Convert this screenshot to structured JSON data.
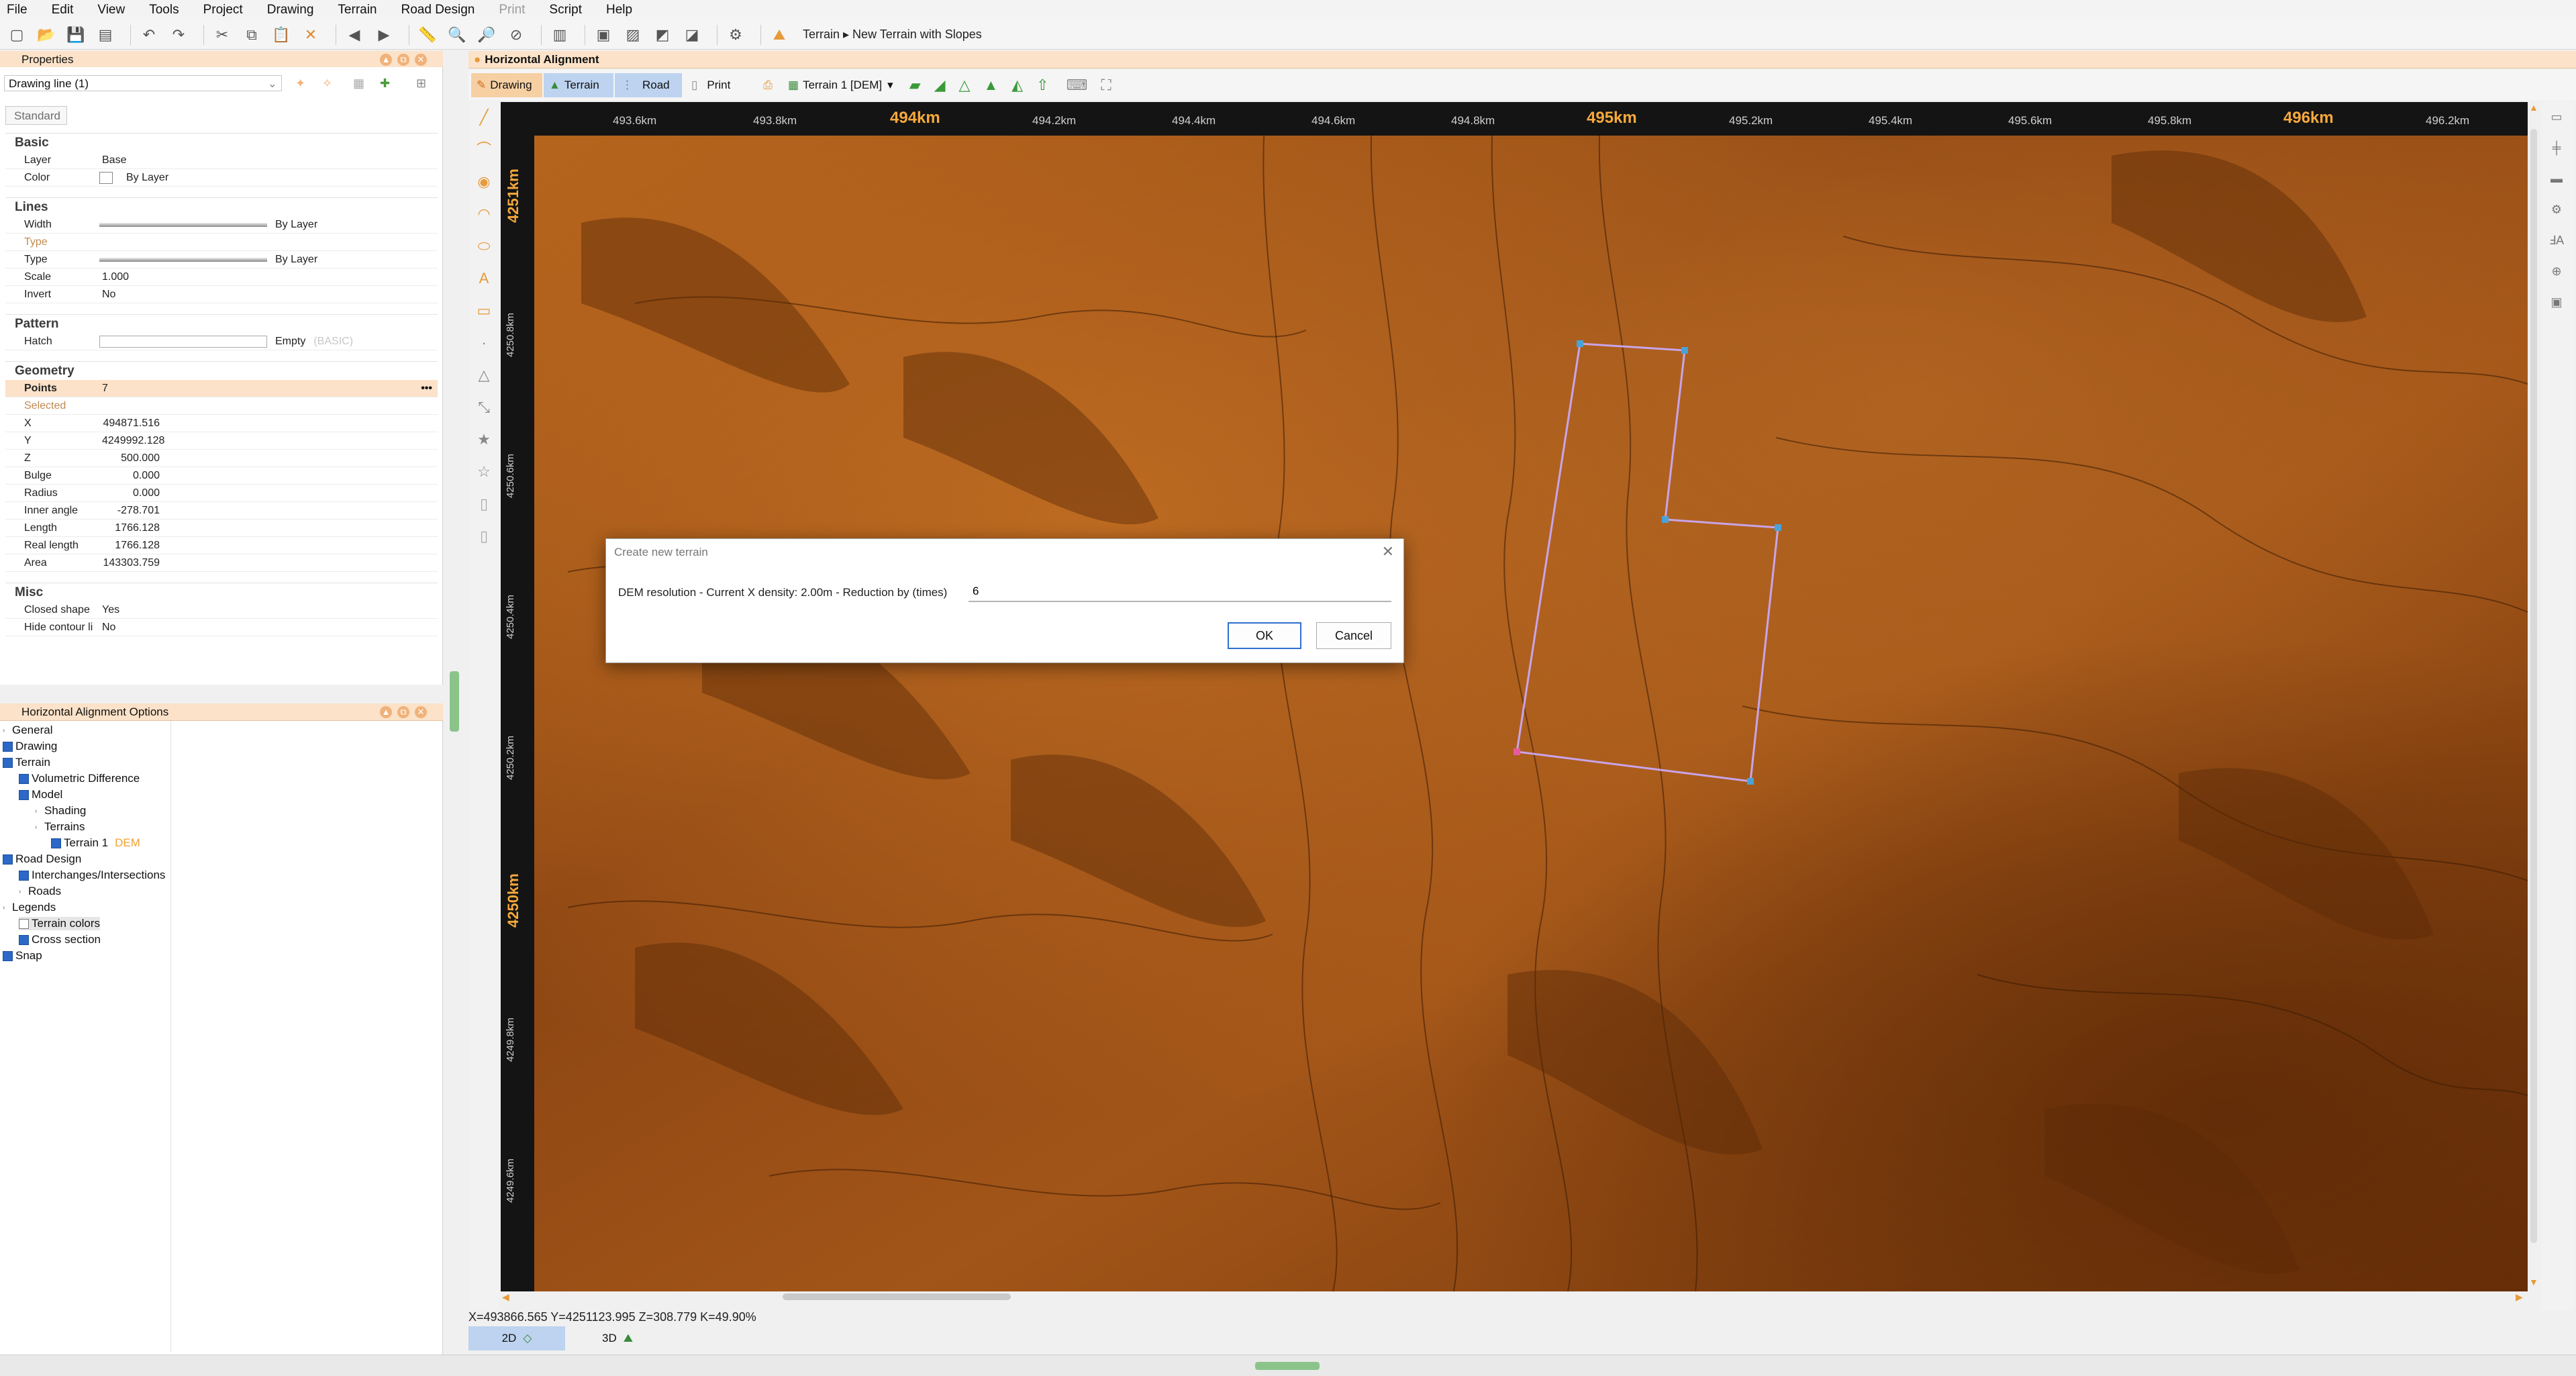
{
  "menu": {
    "items": [
      "File",
      "Edit",
      "View",
      "Tools",
      "Project",
      "Drawing",
      "Terrain",
      "Road Design",
      "Print",
      "Script",
      "Help"
    ],
    "disabled": [
      "Print"
    ]
  },
  "toolbar": {
    "breadcrumb": "Terrain ▸ New Terrain with Slopes"
  },
  "properties_panel": {
    "title": "Properties",
    "selector": "Drawing line (1)",
    "tab": "Standard",
    "sections": {
      "basic": "Basic",
      "lines": "Lines",
      "pattern": "Pattern",
      "geometry": "Geometry",
      "misc": "Misc"
    },
    "rows": {
      "layer_k": "Layer",
      "layer_v": "Base",
      "color_k": "Color",
      "color_v": "By Layer",
      "width_k": "Width",
      "width_v": "By Layer",
      "type_hdr": "Type",
      "type_k": "Type",
      "type_v": "By Layer",
      "scale_k": "Scale",
      "scale_v": "1.000",
      "invert_k": "Invert",
      "invert_v": "No",
      "hatch_k": "Hatch",
      "hatch_v": "Empty",
      "hatch_note": "(BASIC)",
      "points_k": "Points",
      "points_v": "7",
      "selected": "Selected",
      "x_k": "X",
      "x_v": "494871.516",
      "y_k": "Y",
      "y_v": "4249992.128",
      "z_k": "Z",
      "z_v": "500.000",
      "bulge_k": "Bulge",
      "bulge_v": "0.000",
      "radius_k": "Radius",
      "radius_v": "0.000",
      "inner_k": "Inner angle",
      "inner_v": "-278.701",
      "length_k": "Length",
      "length_v": "1766.128",
      "reallen_k": "Real length",
      "reallen_v": "1766.128",
      "area_k": "Area",
      "area_v": "143303.759",
      "closed_k": "Closed shape",
      "closed_v": "Yes",
      "hidecont_k": "Hide contour li",
      "hidecont_v": "No"
    }
  },
  "options_panel": {
    "title": "Horizontal Alignment Options",
    "tree": {
      "general": "General",
      "drawing": "Drawing",
      "terrain": "Terrain",
      "voldiff": "Volumetric Difference",
      "model": "Model",
      "shading": "Shading",
      "terrains": "Terrains",
      "terrain1": "Terrain 1",
      "terrain1_tag": "DEM",
      "road_design": "Road Design",
      "interchanges": "Interchanges/Intersections",
      "roads": "Roads",
      "legends": "Legends",
      "terrain_colors": "Terrain colors",
      "cross_section": "Cross section",
      "snap": "Snap"
    }
  },
  "document": {
    "title": "Horizontal Alignment",
    "tabs": {
      "drawing": "Drawing",
      "terrain": "Terrain",
      "road": "Road",
      "print": "Print"
    },
    "terrain_select": "Terrain 1 [DEM]"
  },
  "ruler": {
    "top": [
      "493.6km",
      "493.8km",
      "494km",
      "494.2km",
      "494.4km",
      "494.6km",
      "494.8km",
      "495km",
      "495.2km",
      "495.4km",
      "495.6km",
      "495.8km",
      "496km",
      "496.2km"
    ],
    "left": [
      "4251km",
      "4250.8km",
      "4250.6km",
      "4250.4km",
      "4250.2km",
      "4250km",
      "4249.8km",
      "4249.6km"
    ]
  },
  "dialog": {
    "title": "Create new terrain",
    "label": "DEM resolution - Current X density: 2.00m - Reduction by (times)",
    "value": "6",
    "ok": "OK",
    "cancel": "Cancel"
  },
  "status": {
    "coords": "X=493866.565  Y=4251123.995  Z=308.779  K=49.90%"
  },
  "bottom_tabs": {
    "two_d": "2D",
    "three_d": "3D"
  },
  "colors": {
    "accent": "#f7a93b",
    "panel_header": "#fbe2c8",
    "terrain": "#7a3a0c",
    "polygon": "#c9a4e8",
    "vertex": "#4aa3d8"
  }
}
